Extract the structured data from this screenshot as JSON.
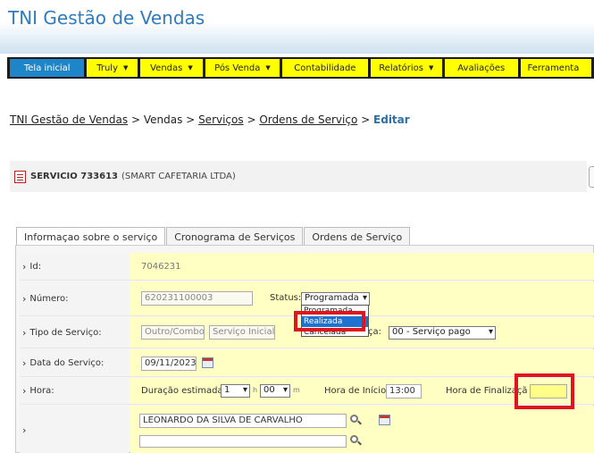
{
  "app": {
    "title": "TNI Gestão de Vendas"
  },
  "menu": [
    {
      "label": "Tela inicial",
      "has_arrow": false,
      "active": true
    },
    {
      "label": "Truly",
      "has_arrow": true
    },
    {
      "label": "Vendas",
      "has_arrow": true
    },
    {
      "label": "Pós Venda",
      "has_arrow": true
    },
    {
      "label": "Contabilidade",
      "has_arrow": false
    },
    {
      "label": "Relatórios",
      "has_arrow": true
    },
    {
      "label": "Avaliações",
      "has_arrow": false
    },
    {
      "label": "Ferramenta",
      "has_arrow": false
    }
  ],
  "breadcrumb": {
    "home": "TNI Gestão de Vendas",
    "sep": ">",
    "vendas": "Vendas",
    "servicos": "Serviços",
    "ordens": "Ordens de Serviço",
    "current": "Editar"
  },
  "service": {
    "title": "SERVICIO 733613",
    "client": "(SMART CAFETARIA LTDA)"
  },
  "tabs": [
    "Informaçao sobre o serviço",
    "Cronograma de Serviços",
    "Ordens de Serviço"
  ],
  "form": {
    "id_label": "Id:",
    "id_value": "7046231",
    "numero_label": "Número:",
    "numero_value": "620231100003",
    "status_label": "Status:",
    "status_value": "Programada",
    "status_options": [
      "Programada",
      "Realizada",
      "Cancelada"
    ],
    "tipo_label": "Tipo de Serviço:",
    "tipo_opt1": "Outro/Combo",
    "tipo_opt2": "Serviço Inicial",
    "cobranca_partial": "ça:",
    "cobranca_value": "00 - Serviço pago",
    "data_label": "Data do Serviço:",
    "data_value": "09/11/2023",
    "hora_label": "Hora:",
    "duracao_label": "Duração estimada:",
    "duracao_h": "1",
    "h_unit": "h",
    "duracao_m": "00",
    "m_unit": "m",
    "inicio_label": "Hora de Início:",
    "inicio_value": "13:00",
    "fim_label": "Hora de Finalizaçã",
    "fim_value": "",
    "tecnico1": "LEONARDO DA SILVA DE CARVALHO",
    "tecnico2": ""
  },
  "colors": {
    "accent": "#2f7bbf",
    "menu_active": "#1e86c8",
    "menu_item": "#ffff00",
    "highlight": "#e0141c"
  }
}
